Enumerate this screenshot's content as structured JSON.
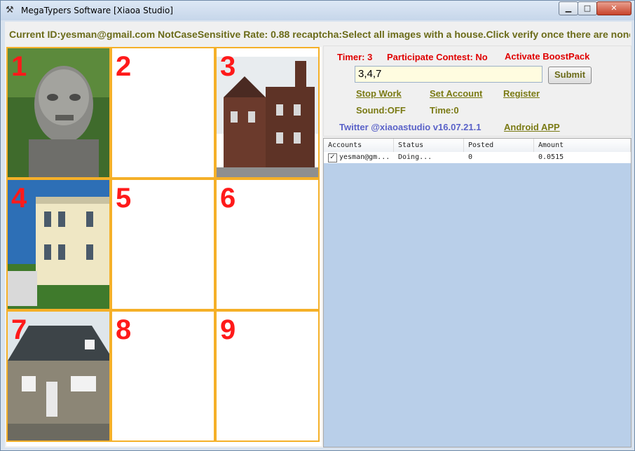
{
  "window": {
    "title": "MegaTypers Software [Xiaoa Studio]"
  },
  "info": {
    "text": "Current ID:yesman@gmail.com NotCaseSensitive Rate: 0.88 recaptcha:Select all images with a house.Click verify once there are none left.. Select no"
  },
  "grid": {
    "cells": [
      "1",
      "2",
      "3",
      "4",
      "5",
      "6",
      "7",
      "8",
      "9"
    ]
  },
  "status": {
    "timer": "Timer: 3",
    "contest": "Participate Contest: No",
    "boost": "Activate BoostPack"
  },
  "answer": {
    "value": "3,4,7",
    "submit": "Submit"
  },
  "links": {
    "stop_work": "Stop Work",
    "set_account": "Set Account",
    "register": "Register",
    "android": "Android APP"
  },
  "labels": {
    "sound": "Sound:OFF",
    "time": "Time:0",
    "twitter": "Twitter @xiaoastudio v16.07.21.1"
  },
  "table": {
    "columns": [
      "Accounts",
      "Status",
      "Posted",
      "Amount"
    ],
    "rows": [
      {
        "checked": true,
        "account": "yesman@gm...",
        "status": "Doing...",
        "posted": "0",
        "amount": "0.0515"
      }
    ]
  },
  "colors": {
    "accent_red": "#e00000",
    "olive": "#7a7a14",
    "grid_border": "#f5b028",
    "list_bg": "#b9cfe9"
  }
}
